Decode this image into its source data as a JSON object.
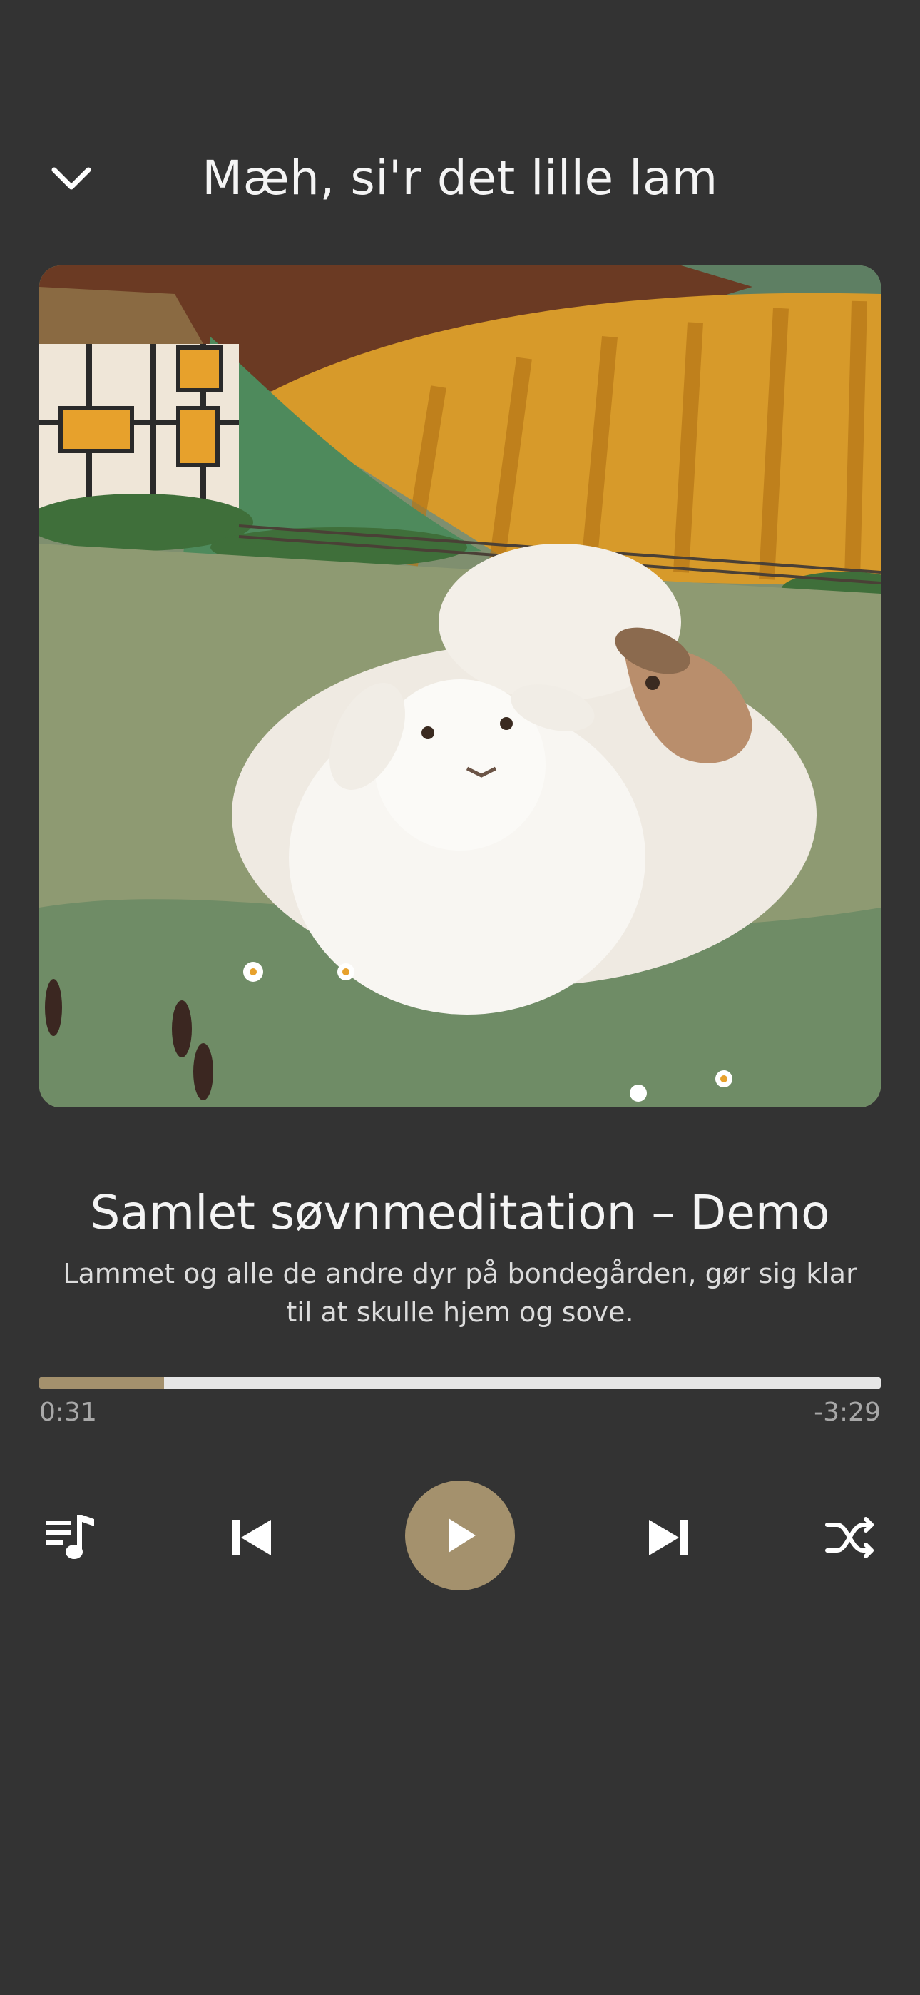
{
  "header": {
    "title": "Mæh, si'r det lille lam",
    "collapse_icon": "chevron-down-icon"
  },
  "artwork": {
    "subject": "painting"
  },
  "track": {
    "title": "Samlet søvnmeditation – Demo",
    "description": "Lammet og alle de andre dyr på bondegården, gør sig klar til at skulle hjem og sove."
  },
  "progress": {
    "elapsed": "0:31",
    "remaining": "-3:29",
    "fraction": 0.148
  },
  "controls": {
    "queue_icon": "playlist-music-icon",
    "previous_icon": "skip-previous-icon",
    "play_icon": "play-icon",
    "next_icon": "skip-next-icon",
    "shuffle_icon": "shuffle-icon"
  },
  "colors": {
    "background": "#333333",
    "accent": "#a4916d",
    "progress_track": "#e6e6e6",
    "text_primary": "#f4f4f4",
    "text_secondary": "#a8a8a8"
  }
}
